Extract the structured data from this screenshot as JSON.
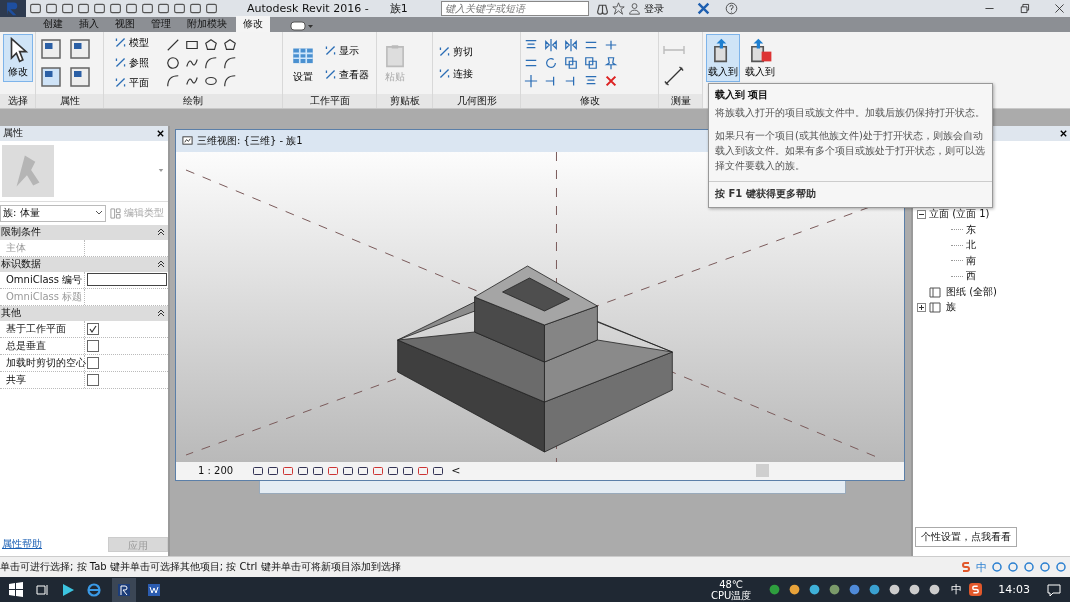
{
  "title_bar": {
    "title": "Autodesk Revit 2016 -",
    "document": "族1",
    "search": {
      "placeholder": "键入关键字或短语"
    },
    "user": "登录"
  },
  "tabs": [
    {
      "label": "创建",
      "selected": false
    },
    {
      "label": "插入",
      "selected": false
    },
    {
      "label": "视图",
      "selected": false
    },
    {
      "label": "管理",
      "selected": false
    },
    {
      "label": "附加模块",
      "selected": false
    },
    {
      "label": "修改",
      "selected": true
    }
  ],
  "ribbon": {
    "panels": [
      {
        "label": "选择",
        "tools": [
          {
            "kind": "large",
            "label": "修改",
            "active": true,
            "disabled": false
          }
        ]
      },
      {
        "label": "属性"
      },
      {
        "label": "绘制",
        "tools": [
          {
            "kind": "small",
            "label": "模型",
            "active": false,
            "disabled": false
          },
          {
            "kind": "small",
            "label": "参照",
            "active": false,
            "disabled": false
          },
          {
            "kind": "small",
            "label": "平面",
            "active": false,
            "disabled": false
          }
        ]
      },
      {
        "label": "工作平面",
        "tools": [
          {
            "kind": "large",
            "label": "设置",
            "active": false,
            "disabled": false
          },
          {
            "kind": "small",
            "label": "显示",
            "active": false,
            "disabled": false
          },
          {
            "kind": "small",
            "label": "查看器",
            "active": false,
            "disabled": false
          }
        ]
      },
      {
        "label": "剪贴板",
        "tools": [
          {
            "kind": "large",
            "label": "粘贴",
            "active": false,
            "disabled": true
          }
        ]
      },
      {
        "label": "几何图形",
        "tools": [
          {
            "kind": "small",
            "label": "剪切",
            "active": false,
            "disabled": false
          },
          {
            "kind": "small",
            "label": "连接",
            "active": false,
            "disabled": false
          }
        ]
      },
      {
        "label": "修改"
      },
      {
        "label": "测量"
      },
      {
        "tools": [
          {
            "kind": "large",
            "label": "载入到",
            "active": true,
            "disabled": false
          },
          {
            "kind": "large",
            "label": "载入到",
            "active": false,
            "disabled": false
          }
        ]
      }
    ]
  },
  "properties": {
    "title": "属性",
    "type_selector": "族: 体量",
    "edit_type": {
      "label": "编辑类型",
      "disabled": true
    },
    "groups": [
      {
        "label": "限制条件",
        "expanded": true,
        "rows": [
          {
            "kind": "text",
            "label": "主体",
            "disabled": true
          }
        ]
      },
      {
        "label": "标识数据",
        "expanded": true,
        "rows": [
          {
            "kind": "input",
            "label": "OmniClass 编号",
            "disabled": false
          },
          {
            "kind": "text",
            "label": "OmniClass 标题",
            "disabled": true
          }
        ]
      },
      {
        "label": "其他",
        "expanded": true,
        "rows": [
          {
            "kind": "checkbox",
            "label": "基于工作平面",
            "checked": true,
            "disabled": false
          },
          {
            "kind": "checkbox",
            "label": "总是垂直",
            "checked": false,
            "disabled": false
          },
          {
            "kind": "checkbox",
            "label": "加载时剪切的空心",
            "checked": false,
            "disabled": false
          },
          {
            "kind": "checkbox",
            "label": "共享",
            "checked": false,
            "disabled": false
          }
        ]
      }
    ],
    "help_link": "属性帮助",
    "apply": {
      "label": "应用",
      "disabled": true
    }
  },
  "view": {
    "title": "三维视图: {三维} - 族1",
    "scale": "1 : 200",
    "chevron": "<"
  },
  "project_browser": {
    "tree": [
      {
        "label": "立面 (立面 1)",
        "expanded": true,
        "children": [
          {
            "label": "东"
          },
          {
            "label": "北"
          },
          {
            "label": "南"
          },
          {
            "label": "西"
          }
        ]
      },
      {
        "label": "图纸 (全部)"
      },
      {
        "label": "族",
        "expanded": false
      }
    ]
  },
  "tooltip": {
    "title": "载入到 项目",
    "paragraphs": [
      "将族载入打开的项目或族文件中。加载后族仍保持打开状态。",
      "如果只有一个项目(或其他族文件)处于打开状态，则族会自动载入到该文件。如果有多个项目或族处于打开状态，则可以选择文件要载入的族。"
    ],
    "footer": "按 F1 键获得更多帮助"
  },
  "status_bar": "单击可进行选择; 按 Tab 键并单击可选择其他项目; 按 Ctrl 键并单击可将新项目添加到选择",
  "hint": "个性设置，点我看看",
  "ime_bar": {
    "label": "中"
  },
  "taskbar": {
    "cpu_temp": "48℃",
    "cpu_label": "CPU温度",
    "ime": "中",
    "time": "14:03"
  }
}
